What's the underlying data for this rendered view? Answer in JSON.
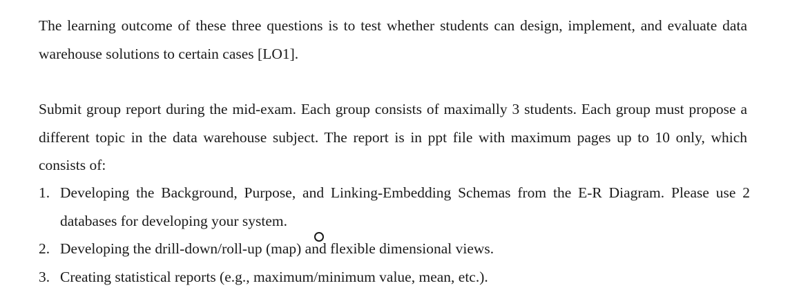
{
  "document": {
    "paragraph_1": "The learning outcome of these three questions is to test whether students can design, implement, and evaluate data warehouse solutions to certain cases [LO1].",
    "paragraph_2": "Submit group report during the mid-exam. Each group consists of maximally 3 students. Each group must propose a different topic in the data warehouse subject. The report is in ppt file with maximum pages up to 10 only, which consists of:",
    "list": [
      {
        "number": "1.",
        "text": "Developing the Background, Purpose, and Linking-Embedding Schemas from the E-R Diagram. Please use 2 databases for developing your system."
      },
      {
        "number": "2.",
        "text": "Developing the drill-down/roll-up (map) and flexible dimensional views."
      },
      {
        "number": "3.",
        "text": "Creating statistical reports (e.g., maximum/minimum value, mean, etc.)."
      }
    ]
  },
  "cursor": {
    "icon": "circle-cursor-icon"
  }
}
